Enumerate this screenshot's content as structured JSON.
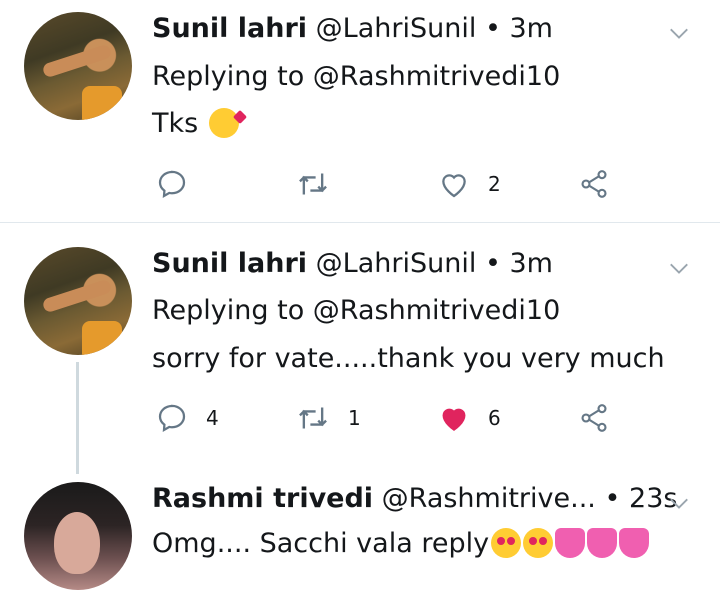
{
  "tweets": [
    {
      "name": "Sunil lahri",
      "handle": "@LahriSunil",
      "separator": "•",
      "time": "3m",
      "replying_to": "Replying to @Rashmitrivedi10",
      "text": "Tks",
      "emojis": [
        "face-blowing-kiss"
      ],
      "reply_count": "",
      "retweet_count": "",
      "like_count": "2",
      "liked": false
    },
    {
      "name": "Sunil lahri",
      "handle": "@LahriSunil",
      "separator": "•",
      "time": "3m",
      "replying_to": "Replying to @Rashmitrivedi10",
      "text": "sorry for vate.....thank you very much",
      "reply_count": "4",
      "retweet_count": "1",
      "like_count": "6",
      "liked": true
    },
    {
      "name": "Rashmi trivedi",
      "handle": "@Rashmitrive...",
      "separator": "•",
      "time": "23s",
      "text": "Omg.... Sacchi vala reply",
      "emojis": [
        "heart-eyes",
        "heart-eyes",
        "sparkling-heart",
        "sparkling-heart",
        "sparkling-heart"
      ]
    }
  ],
  "colors": {
    "icon_gray": "#657786",
    "like_red": "#e0245e",
    "divider": "#e1e8ed",
    "thread_line": "#cfd9de"
  },
  "icons": [
    "reply-icon",
    "retweet-icon",
    "like-icon",
    "share-icon",
    "chevron-down-icon"
  ]
}
